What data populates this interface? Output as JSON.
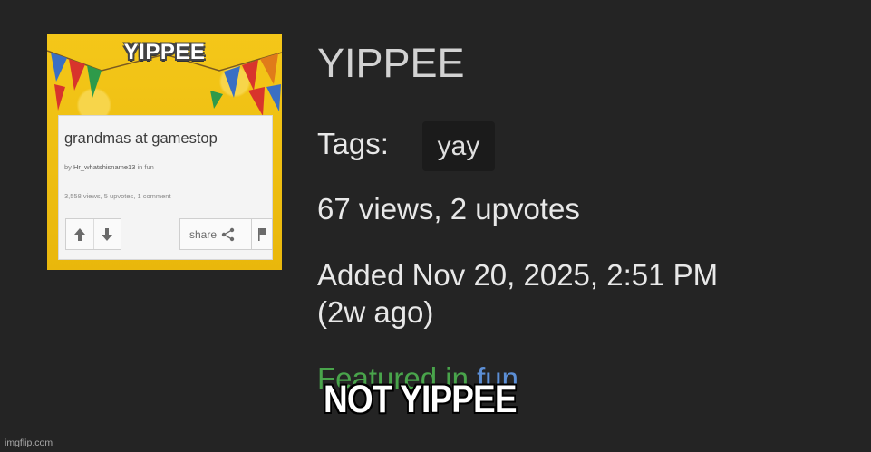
{
  "thumbnail": {
    "title": "YIPPEE",
    "card_title": "grandmas at gamestop",
    "by_prefix": "by",
    "author": "Hr_whatshisname13",
    "in_label": "in",
    "stream": "fun",
    "stats": "3,558 views, 5 upvotes, 1 comment",
    "share_label": "share",
    "icons": [
      "upvote-arrow-icon",
      "downvote-arrow-icon",
      "share-icon",
      "flag-icon"
    ]
  },
  "post": {
    "title": "YIPPEE",
    "tags_label": "Tags:",
    "tags": [
      "yay"
    ],
    "stats": "67 views, 2 upvotes",
    "added_line1": "Added Nov 20, 2025, 2:51 PM",
    "added_line2": "(2w ago)",
    "featured_prefix": "Featured in ",
    "featured_stream": "fun"
  },
  "overlay_caption": "NOT YIPPEE",
  "watermark": "imgflip.com",
  "colors": {
    "background": "#242424",
    "tag_background": "#1b1b1b",
    "featured_green": "#49a44b",
    "featured_link_blue": "#5c8fd6",
    "thumbnail_yellow": "#f0c21a"
  }
}
